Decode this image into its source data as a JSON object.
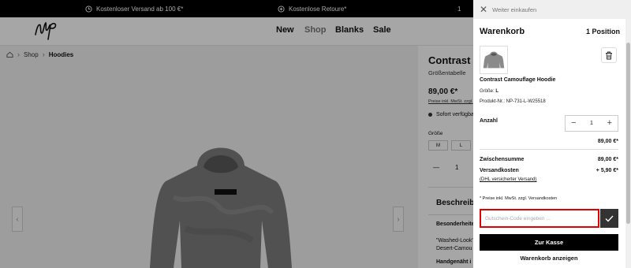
{
  "topbar": {
    "shipping": "Kostenloser Versand ab 100 €*",
    "returns": "Kostenlose Retoure*",
    "partial": "1"
  },
  "nav": {
    "items": [
      "New",
      "Shop",
      "Blanks",
      "Sale"
    ],
    "active": "Shop"
  },
  "breadcrumb": {
    "shop": "Shop",
    "current": "Hoodies"
  },
  "product": {
    "title": "Contrast C",
    "size_chart": "Größentabelle",
    "price": "89,00 €*",
    "price_note": "Preise inkl. MwSt. zzgl.",
    "availability": "Sofort verfügba",
    "size_label": "Größe",
    "sizes": [
      "M",
      "L"
    ],
    "qty_minus": "—",
    "qty_value": "1",
    "description_title": "Beschreibu",
    "features_title": "Besonderheite",
    "feature_line1": "\"Washed-Look\"",
    "feature_line2": "Desert-Camou",
    "care_title": "Handgenäht i"
  },
  "drawer": {
    "back_label": "Weiter einkaufen",
    "title": "Warenkorb",
    "count": "1 Position",
    "item": {
      "name": "Contrast Camouflage Hoodie",
      "size_label": "Größe:",
      "size_value": "L",
      "sku": "Produkt-Nr.: NP-731-L-W25518"
    },
    "quantity_label": "Anzahl",
    "quantity": "1",
    "line_price": "89,00 €*",
    "subtotal_label": "Zwischensumme",
    "subtotal": "89,00 €*",
    "shipping_label": "Versandkosten",
    "shipping": "+ 5,90 €*",
    "shipping_method": "(DHL versicherter Versand)",
    "vat_note": "* Preise inkl. MwSt. zzgl. Versandkosten",
    "voucher_placeholder": "Gutschein-Code eingeben ...",
    "checkout": "Zur Kasse",
    "view_cart": "Warenkorb anzeigen"
  },
  "colors": {
    "highlight": "#e00000",
    "black": "#000000",
    "overlay": "rgba(0,0,0,0.35)"
  }
}
